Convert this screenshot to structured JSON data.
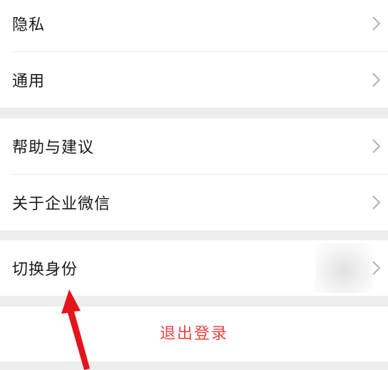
{
  "settings": {
    "items": [
      {
        "label": "隐私"
      },
      {
        "label": "通用"
      },
      {
        "label": "帮助与建议"
      },
      {
        "label": "关于企业微信"
      },
      {
        "label": "切换身份"
      }
    ],
    "logout_label": "退出登录"
  },
  "colors": {
    "background": "#ededed",
    "row": "#ffffff",
    "danger": "#e64340",
    "annotation_arrow": "#e5141a"
  },
  "icons": {
    "chevron": "chevron-right-icon",
    "arrow": "red-pointer-arrow"
  }
}
